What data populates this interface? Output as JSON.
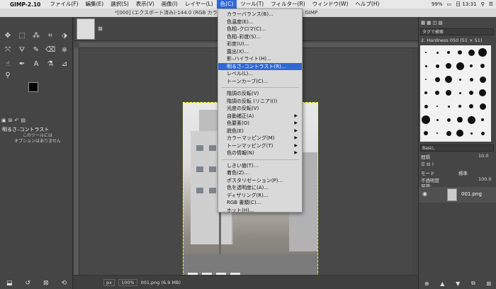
{
  "menubar": {
    "app_name": "GIMP-2.10",
    "items": [
      "ファイル(F)",
      "編集(E)",
      "選択(S)",
      "表示(V)",
      "画像(I)",
      "レイヤー(L)",
      "色(C)",
      "ツール(T)",
      "フィルター(R)",
      "ウィンドウ(W)",
      "ヘルプ(H)"
    ],
    "active_index": 6,
    "battery": "99%",
    "clock": "日 13:31"
  },
  "window_title": "*[000] (エクスポート済み)-144.0 (RGB カラー ... 2.1, 1枚のレイヤー) 350x466 – GIMP",
  "color_menu": {
    "items": [
      {
        "label": "カラーバランス(B)...",
        "submenu": false
      },
      {
        "label": "色温度(E)...",
        "submenu": false
      },
      {
        "label": "色相–クロマ(C)...",
        "submenu": false
      },
      {
        "label": "色相–彩度(S)...",
        "submenu": false
      },
      {
        "label": "彩度(U)...",
        "submenu": false
      },
      {
        "label": "露出(X)...",
        "submenu": false
      },
      {
        "label": "影–ハイライト(H)...",
        "submenu": false
      },
      {
        "label": "明るさ–コントラスト(R)...",
        "submenu": false,
        "highlighted": true
      },
      {
        "label": "レベル(L)...",
        "submenu": false
      },
      {
        "label": "トーンカーブ(C)...",
        "submenu": false
      },
      {
        "sep": true
      },
      {
        "label": "階調の反転(V)",
        "submenu": false
      },
      {
        "label": "階調の反転 (リニア)(I)",
        "submenu": false
      },
      {
        "label": "光度の反転(V)",
        "submenu": false
      },
      {
        "label": "自動補正(A)",
        "submenu": true
      },
      {
        "label": "色要素(O)",
        "submenu": true
      },
      {
        "label": "脱色(E)",
        "submenu": true
      },
      {
        "label": "カラーマッピング(M)",
        "submenu": true
      },
      {
        "label": "トーンマッピング(T)",
        "submenu": true
      },
      {
        "label": "色の情報(N)",
        "submenu": true
      },
      {
        "sep": true
      },
      {
        "label": "しきい値(T)...",
        "submenu": false
      },
      {
        "label": "着色(Z)...",
        "submenu": false
      },
      {
        "label": "ポスタリゼーション(P)...",
        "submenu": false
      },
      {
        "label": "色を透明度に(A)...",
        "submenu": false
      },
      {
        "label": "ディザリング(R)...",
        "submenu": false
      },
      {
        "label": "RGB 書類(C)...",
        "submenu": false
      },
      {
        "label": "ホット(H)...",
        "submenu": false
      }
    ]
  },
  "toolbox": {
    "options_title": "明るさ–コントラスト",
    "options_empty": "このツールには\nオプションはありません"
  },
  "status": {
    "unit": "px",
    "zoom": "100%",
    "filename": "001.png (6.9 MB)"
  },
  "dock": {
    "brush_filter": "タグで検索",
    "brush_name": "2. Hardness 050 (51 × 51)",
    "preset_label": "Basic,",
    "spacing_label": "間隔",
    "spacing_value": "10.0",
    "mode_label": "モード",
    "mode_value": "標準",
    "opacity_label": "不透明度",
    "opacity_value": "100.0",
    "lock_label": "保護:",
    "layer_name": "001.png"
  },
  "colors": {
    "menu_highlight": "#2f69d6",
    "selection_outline": "#ffff00"
  }
}
